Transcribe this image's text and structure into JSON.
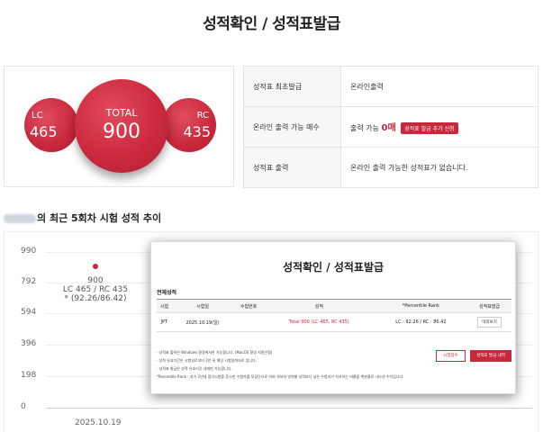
{
  "page_title": "성적확인 / 성적표발급",
  "scores": {
    "lc_label": "LC",
    "lc_value": "465",
    "total_label": "TOTAL",
    "total_value": "900",
    "rc_label": "RC",
    "rc_value": "435"
  },
  "info": {
    "first_issue_label": "성적표 최초발급",
    "first_issue_value": "온라인출력",
    "print_count_label": "온라인 출력 가능 매수",
    "print_count_prefix": "출력 가능",
    "print_count_value": "0매",
    "request_button": "성적표 발급 추가 신청",
    "print_label": "성적표 출력",
    "print_value": "온라인 출력 가능한 성적표가 없습니다."
  },
  "trend": {
    "title_suffix": "의 최근 5회차 시험 성적 추이",
    "yticks": [
      "990",
      "792",
      "594",
      "396",
      "198",
      "0"
    ],
    "point_score": "900",
    "point_detail": "LC 465 / RC 435",
    "point_percent": "* (92.26/86.42)",
    "xtick": "2025.10.19"
  },
  "chart_data": {
    "type": "scatter",
    "x": [
      "2025.10.19"
    ],
    "series": [
      {
        "values": [
          900
        ]
      }
    ],
    "ylim": [
      0,
      990
    ],
    "yticks": [
      990,
      792,
      594,
      396,
      198,
      0
    ]
  },
  "popup": {
    "title": "성적확인 / 성적표발급",
    "section": "전체성적",
    "headers": [
      "시험",
      "시험일",
      "수험번호",
      "성적",
      "*Percentile Rank",
      "성적표발급"
    ],
    "row": {
      "exam": "JPT",
      "date": "2025.10.19(일)",
      "reg_no": "",
      "score": "Total 900 (LC 465, RC 435)",
      "percentile": "LC : 92.26 / RC : 86.42",
      "action": "미리보기"
    },
    "notes": [
      "· 성적표 출력은 Windows 환경에서만 가능합니다. (MacOS 환경 지원안함)",
      "· 성적 유효기간은 시험일로부터 2년 뒤 해당 시험일까지로 입니다.",
      "· 성적표 발급은 성적 유효기간 내에만 가능합니다.",
      "*Percentile Rank : 과거 2년내 정기시험을 응시한 수험자를 모집단으로 하여 귀하의 영역별 성적보다 낮은 수험자가 차지하는 비율을 백분율로 나타낸 수치입니다."
    ],
    "btn_receipt": "시험접수",
    "btn_issue": "성적표 발급 내역"
  }
}
